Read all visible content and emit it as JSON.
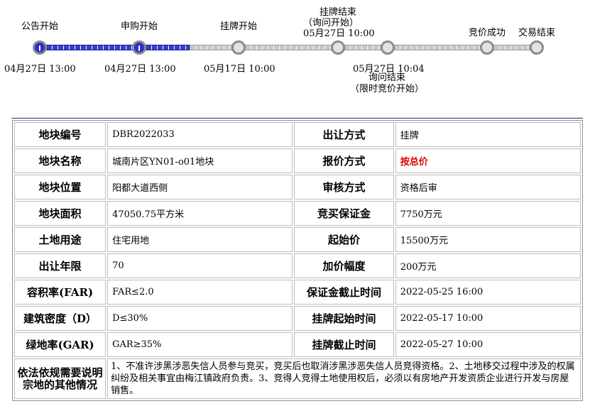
{
  "timeline": {
    "nodes": [
      {
        "label": "公告开始",
        "time": "04月27日 13:00",
        "status": "done"
      },
      {
        "label": "申购开始",
        "time": "04月27日 13:00",
        "status": "done"
      },
      {
        "label": "挂牌开始",
        "time": "05月17日 10:00",
        "status": "todo"
      },
      {
        "label": "挂牌结束",
        "label_sub": "（询问开始）",
        "time": "05月27日 10:00",
        "status": "todo"
      },
      {
        "label": "询问结束",
        "label_sub": "（限时竞价开始）",
        "time": "05月27日 10:04",
        "status": "todo"
      },
      {
        "label": "竞价成功",
        "status": "todo"
      },
      {
        "label": "交易结束",
        "status": "todo"
      }
    ]
  },
  "table": {
    "rows": [
      {
        "k1": "地块编号",
        "v1": "DBR2022033",
        "k2": "出让方式",
        "v2": "挂牌"
      },
      {
        "k1": "地块名称",
        "v1": "城南片区YN01-o01地块",
        "k2": "报价方式",
        "v2": "按总价"
      },
      {
        "k1": "地块位置",
        "v1": "阳都大道西侧",
        "k2": "审核方式",
        "v2": "资格后审"
      },
      {
        "k1": "地块面积",
        "v1": "47050.75平方米",
        "k2": "竞买保证金",
        "v2": "7750万元"
      },
      {
        "k1": "土地用途",
        "v1": "住宅用地",
        "k2": "起始价",
        "v2": "15500万元"
      },
      {
        "k1": "出让年限",
        "v1": "70",
        "k2": "加价幅度",
        "v2": "200万元"
      },
      {
        "k1": "容积率(FAR)",
        "v1": "FAR≤2.0",
        "k2": "保证金截止时间",
        "v2": "2022-05-25 16:00"
      },
      {
        "k1": "建筑密度（D）",
        "v1": "D≤30%",
        "k2": "挂牌起始时间",
        "v2": "2022-05-17 10:00"
      },
      {
        "k1": "绿地率(GAR)",
        "v1": "GAR≥35%",
        "k2": "挂牌截止时间",
        "v2": "2022-05-27 10:00"
      }
    ],
    "note_label": "依法依规需要说明宗地的其他情况",
    "note_text": "1、不准许涉黑涉恶失信人员参与竞买，竞买后也取消涉黑涉恶失信人员竞得资格。2、土地移交过程中涉及的权属纠纷及相关事宜由梅江镇政府负责。3、竞得人竞得土地使用权后，必须以有房地产开发资质企业进行开发与房屋销售。"
  }
}
